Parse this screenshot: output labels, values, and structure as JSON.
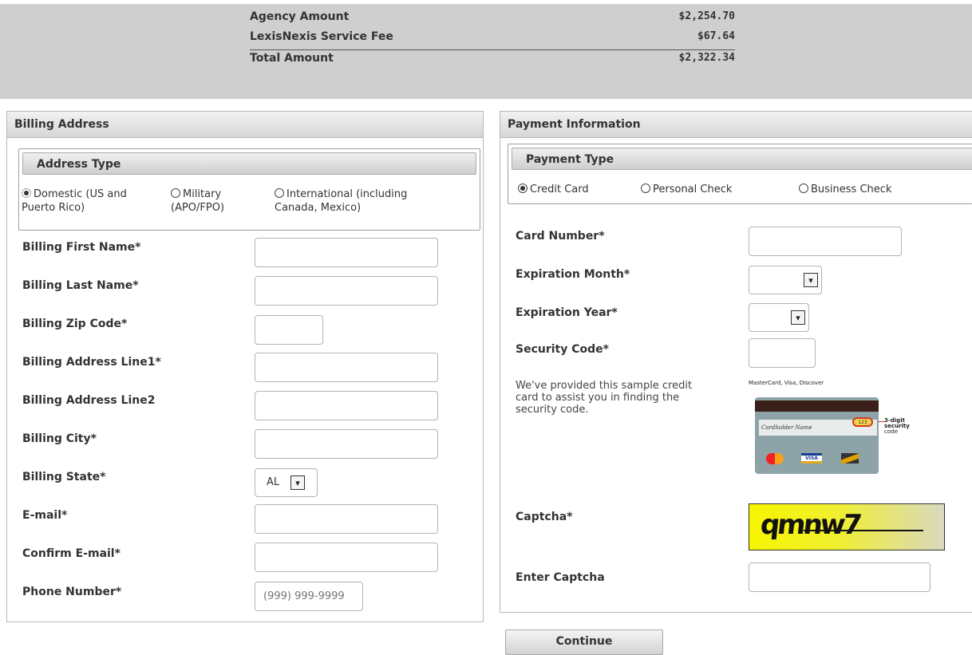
{
  "summary": {
    "agency_label": "Agency Amount",
    "agency_amount": "$2,254.70",
    "fee_label": "LexisNexis Service Fee",
    "fee_amount": "$67.64",
    "total_label": "Total Amount",
    "total_amount": "$2,322.34"
  },
  "billing": {
    "title": "Billing Address",
    "address_type": {
      "title": "Address Type",
      "options": [
        {
          "label_line1": "Domestic (US and",
          "label_line2": "Puerto Rico)",
          "selected": true
        },
        {
          "label_line1": "Military",
          "label_line2": "(APO/FPO)",
          "selected": false
        },
        {
          "label_line1": "International (including",
          "label_line2": "Canada, Mexico)",
          "selected": false
        }
      ]
    },
    "fields": {
      "first_name": {
        "label": "Billing First Name*",
        "value": ""
      },
      "last_name": {
        "label": "Billing Last Name*",
        "value": ""
      },
      "zip": {
        "label": "Billing Zip Code*",
        "value": ""
      },
      "line1": {
        "label": "Billing Address Line1*",
        "value": ""
      },
      "line2": {
        "label": "Billing Address Line2",
        "value": ""
      },
      "city": {
        "label": "Billing City*",
        "value": ""
      },
      "state": {
        "label": "Billing State*",
        "value": "AL"
      },
      "email": {
        "label": "E-mail*",
        "value": ""
      },
      "confirm_email": {
        "label": "Confirm E-mail*",
        "value": ""
      },
      "phone": {
        "label": "Phone Number*",
        "placeholder": "(999) 999-9999"
      }
    }
  },
  "payment": {
    "title": "Payment Information",
    "payment_type": {
      "title": "Payment Type",
      "options": [
        {
          "label": "Credit Card",
          "selected": true
        },
        {
          "label": "Personal Check",
          "selected": false
        },
        {
          "label": "Business Check",
          "selected": false
        }
      ]
    },
    "fields": {
      "card_number": {
        "label": "Card Number*",
        "value": ""
      },
      "exp_month": {
        "label": "Expiration Month*",
        "value": ""
      },
      "exp_year": {
        "label": "Expiration Year*",
        "value": ""
      },
      "security_code": {
        "label": "Security Code*",
        "value": ""
      },
      "captcha": {
        "label": "Captcha*",
        "text": "qmnw7"
      },
      "enter_captcha": {
        "label": "Enter Captcha",
        "value": ""
      }
    },
    "help_text": [
      "We've provided this sample credit",
      "card to assist you in finding the",
      "security code."
    ],
    "card_image": {
      "brands_caption": "MasterCard, Visa, Discover",
      "cardholder_text": "Cardholder Name",
      "code_caption_line1": "3-digit",
      "code_caption_line2": "security",
      "code_caption_line3": "code",
      "visa_label": "VISA",
      "code_value": "123"
    }
  },
  "actions": {
    "continue_label": "Continue"
  },
  "colors": {
    "summary_bg": "#cfcfcf",
    "captcha_yellow": "#f7f500"
  },
  "icons": {
    "select_arrow": "chevron-down-icon",
    "radio": "radio-icon"
  }
}
